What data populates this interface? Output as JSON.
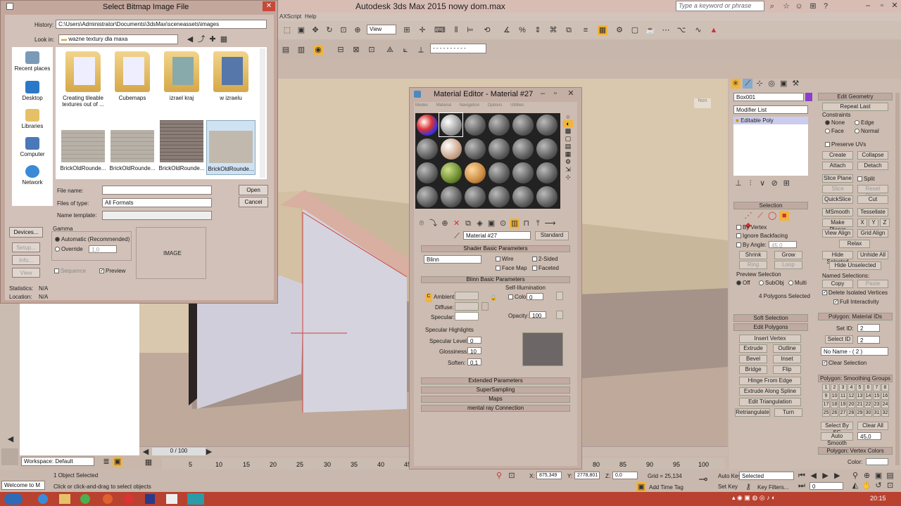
{
  "app": {
    "title": "Autodesk 3ds Max  2015     nowy dom.max",
    "search_placeholder": "Type a keyword or phrase",
    "menus": [
      "AXScript",
      "Help"
    ],
    "view_dropdown": "View"
  },
  "file_dialog": {
    "title": "Select Bitmap Image File",
    "history_label": "History:",
    "history_value": "C:\\Users\\Administrator\\Documents\\3dsMax\\sceneassets\\images",
    "lookin_label": "Look in:",
    "lookin_value": "wazne textury dla maxa",
    "places": [
      "Recent places",
      "Desktop",
      "Libraries",
      "Computer",
      "Network"
    ],
    "items": [
      {
        "name": "Creating tileable textures out of ...",
        "kind": "folder"
      },
      {
        "name": "Cubemaps",
        "kind": "folder"
      },
      {
        "name": "izrael kraj",
        "kind": "folder"
      },
      {
        "name": "w izraelu",
        "kind": "folder"
      },
      {
        "name": "BrickOldRounde...",
        "kind": "image"
      },
      {
        "name": "BrickOldRounde...",
        "kind": "image"
      },
      {
        "name": "BrickOldRounde...",
        "kind": "image"
      },
      {
        "name": "BrickOldRounde...",
        "kind": "image"
      }
    ],
    "filename_label": "File name:",
    "filename_value": "",
    "filetype_label": "Files of type:",
    "filetype_value": "All Formats",
    "nametemplate_label": "Name template:",
    "open_label": "Open",
    "cancel_label": "Cancel",
    "devices_label": "Devices...",
    "setup_label": "Setup...",
    "info_label": "Info...",
    "view_label": "View",
    "gamma_label": "Gamma",
    "gamma_auto": "Automatic (Recommended)",
    "gamma_override": "Override",
    "gamma_override_value": "1,0",
    "sequence_label": "Sequence",
    "preview_label": "Preview",
    "image_placeholder": "IMAGE",
    "statistics_label": "Statistics:",
    "statistics_value": "N/A",
    "location_label": "Location:",
    "location_value": "N/A"
  },
  "material_editor": {
    "title": "Material Editor - Material #27",
    "menus": [
      "Modes",
      "Material",
      "Navigation",
      "Options",
      "Utilities"
    ],
    "material_name": "Material #27",
    "material_type": "Standard",
    "shader_rollout": "Shader Basic Parameters",
    "shader": "Blinn",
    "wire": "Wire",
    "two_sided": "2-Sided",
    "face_map": "Face Map",
    "faceted": "Faceted",
    "blinn_rollout": "Blinn Basic Parameters",
    "self_illumination": "Self-Illumination",
    "ambient": "Ambient:",
    "diffuse": "Diffuse:",
    "specular": "Specular:",
    "color": "Color",
    "color_value": "0",
    "opacity_label": "Opacity:",
    "opacity_value": "100",
    "spec_highlights": "Specular Highlights",
    "spec_level_label": "Specular Level:",
    "spec_level_value": "0",
    "glossiness_label": "Glossiness:",
    "glossiness_value": "10",
    "soften_label": "Soften:",
    "soften_value": "0,1",
    "rollups": [
      "Extended Parameters",
      "SuperSampling",
      "Maps",
      "mental ray Connection"
    ]
  },
  "command_panel": {
    "object_name": "Box001",
    "modifier_list": "Modifier List",
    "stack_item": "Editable Poly",
    "selection_header": "Selection",
    "by_vertex": "By Vertex",
    "ignore_backfacing": "Ignore Backfacing",
    "by_angle": "By Angle:",
    "by_angle_value": "45,0",
    "shrink": "Shrink",
    "grow": "Grow",
    "ring": "Ring",
    "loop": "Loop",
    "preview_selection": "Preview Selection",
    "preview_off": "Off",
    "preview_subobj": "SubObj",
    "preview_multi": "Multi",
    "polygons_selected": "4 Polygons Selected",
    "soft_selection": "Soft Selection",
    "edit_polygons": "Edit Polygons",
    "insert_vertex": "Insert Vertex",
    "extrude": "Extrude",
    "outline": "Outline",
    "bevel": "Bevel",
    "inset": "Inset",
    "bridge": "Bridge",
    "flip": "Flip",
    "hinge_from_edge": "Hinge From Edge",
    "extrude_along_spline": "Extrude Along Spline",
    "edit_triangulation": "Edit Triangulation",
    "retriangulate": "Retriangulate",
    "turn": "Turn"
  },
  "edit_geometry": {
    "header": "Edit Geometry",
    "repeat_last": "Repeat Last",
    "constraints": "Constraints",
    "none": "None",
    "edge": "Edge",
    "face": "Face",
    "normal": "Normal",
    "preserve_uvs": "Preserve UVs",
    "create": "Create",
    "collapse": "Collapse",
    "attach": "Attach",
    "detach": "Detach",
    "slice_plane": "Slice Plane",
    "split": "Split",
    "slice": "Slice",
    "reset_plane": "Reset Plane",
    "quickslice": "QuickSlice",
    "cut": "Cut",
    "msmooth": "MSmooth",
    "tessellate": "Tessellate",
    "make_planar": "Make Planar",
    "x": "X",
    "y": "Y",
    "z": "Z",
    "view_align": "View Align",
    "grid_align": "Grid Align",
    "relax": "Relax",
    "hide_selected": "Hide Selected",
    "unhide_all": "Unhide All",
    "hide_unselected": "Hide Unselected",
    "named_selections": "Named Selections:",
    "copy": "Copy",
    "paste": "Paste",
    "delete_isolated": "Delete Isolated Vertices",
    "full_interactivity": "Full Interactivity",
    "material_ids_header": "Polygon: Material IDs",
    "set_id": "Set ID:",
    "set_id_value": "2",
    "select_id": "Select ID",
    "select_id_value": "2",
    "name_dropdown": "No Name - ( 2 )",
    "clear_selection": "Clear Selection",
    "smoothing_header": "Polygon: Smoothing Groups",
    "smoothing_groups": [
      "1",
      "2",
      "3",
      "4",
      "5",
      "6",
      "7",
      "8",
      "9",
      "10",
      "11",
      "12",
      "13",
      "14",
      "15",
      "16",
      "17",
      "18",
      "19",
      "20",
      "21",
      "22",
      "23",
      "24",
      "25",
      "26",
      "27",
      "28",
      "29",
      "30",
      "31",
      "32"
    ],
    "select_by_sg": "Select By SG",
    "clear_all": "Clear All",
    "auto_smooth": "Auto Smooth",
    "auto_smooth_value": "45,0",
    "vertex_colors_header": "Polygon: Vertex Colors",
    "color_label": "Color:"
  },
  "status": {
    "workspace": "Workspace: Default",
    "welcome": "Welcome to M",
    "objects_selected": "1 Object Selected",
    "prompt": "Click or click-and-drag to select objects",
    "timeline": "0 / 100",
    "ruler": [
      "5",
      "10",
      "15",
      "20",
      "25",
      "30",
      "35",
      "40",
      "45",
      "80",
      "85",
      "90",
      "95",
      "100"
    ],
    "x_label": "X:",
    "x_value": "875,349",
    "y_label": "Y:",
    "y_value": "2778,801",
    "z_label": "Z:",
    "z_value": "0,0",
    "grid": "Grid = 25,134",
    "add_time_tag": "Add Time Tag",
    "auto_key": "Auto Key",
    "set_key": "Set Key",
    "selected": "Selected",
    "key_filters": "Key Filters...",
    "frame": "0",
    "clock": "20:15"
  }
}
